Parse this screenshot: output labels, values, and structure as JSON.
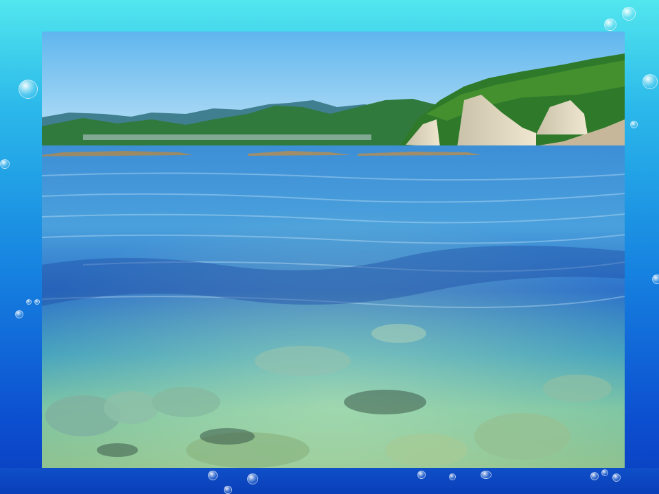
{
  "slide": {
    "background_colors": [
      "#52e6ee",
      "#1682e0",
      "#0a3fc0"
    ],
    "photo_subject": "coastal-seascape"
  }
}
